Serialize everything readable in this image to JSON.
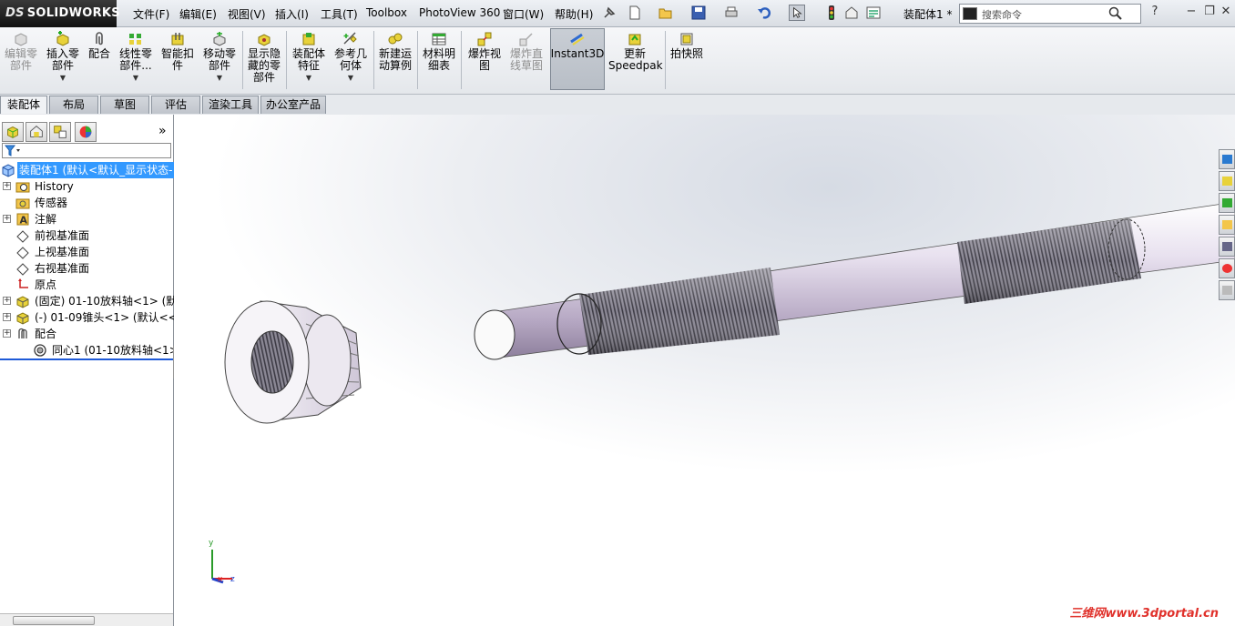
{
  "app": {
    "logo_text": "SOLIDWORKS",
    "logo_prefix": "DS"
  },
  "menu": [
    "文件(F)",
    "编辑(E)",
    "视图(V)",
    "插入(I)",
    "工具(T)",
    "Toolbox",
    "PhotoView 360",
    "窗口(W)",
    "帮助(H)"
  ],
  "document_title": "装配体1 *",
  "search": {
    "placeholder": "搜索命令"
  },
  "window_controls": {
    "help": "?",
    "minimize": "−",
    "restore": "❐",
    "close": "✕"
  },
  "command_manager": {
    "items": [
      {
        "label": "编辑零\n部件",
        "disabled": true,
        "dropdown": false
      },
      {
        "label": "插入零\n部件",
        "disabled": false,
        "dropdown": true
      },
      {
        "label": "配合",
        "disabled": false,
        "dropdown": false
      },
      {
        "label": "线性零\n部件...",
        "disabled": false,
        "dropdown": true
      },
      {
        "label": "智能扣\n件",
        "disabled": false,
        "dropdown": false
      },
      {
        "label": "移动零\n部件",
        "disabled": false,
        "dropdown": true
      },
      {
        "label": "显示隐\n藏的零\n部件",
        "disabled": false,
        "dropdown": false
      },
      {
        "label": "装配体\n特征",
        "disabled": false,
        "dropdown": true
      },
      {
        "label": "参考几\n何体",
        "disabled": false,
        "dropdown": true
      },
      {
        "label": "新建运\n动算例",
        "disabled": false,
        "dropdown": false
      },
      {
        "label": "材料明\n细表",
        "disabled": false,
        "dropdown": false
      },
      {
        "label": "爆炸视\n图",
        "disabled": false,
        "dropdown": false
      },
      {
        "label": "爆炸直\n线草图",
        "disabled": true,
        "dropdown": false
      },
      {
        "label": "Instant3D",
        "disabled": false,
        "dropdown": false
      },
      {
        "label": "更新\nSpeedpak",
        "disabled": false,
        "dropdown": false
      },
      {
        "label": "拍快照",
        "disabled": false,
        "dropdown": false
      }
    ]
  },
  "tabs": [
    "装配体",
    "布局",
    "草图",
    "评估",
    "渲染工具",
    "办公室产品"
  ],
  "feature_tree": {
    "expand_arrow": "»",
    "filter_icon": "filter-icon",
    "root": "装配体1  (默认<默认_显示状态-",
    "items": [
      {
        "label": "History",
        "icon": "history-folder-icon",
        "expandable": true
      },
      {
        "label": "传感器",
        "icon": "sensor-folder-icon",
        "expandable": false
      },
      {
        "label": "注解",
        "icon": "annotation-icon",
        "expandable": true
      },
      {
        "label": "前视基准面",
        "icon": "plane-icon",
        "expandable": false
      },
      {
        "label": "上视基准面",
        "icon": "plane-icon",
        "expandable": false
      },
      {
        "label": "右视基准面",
        "icon": "plane-icon",
        "expandable": false
      },
      {
        "label": "原点",
        "icon": "origin-icon",
        "expandable": false
      },
      {
        "label": "(固定) 01-10放料轴<1> (默",
        "icon": "part-icon",
        "expandable": true
      },
      {
        "label": "(-) 01-09锥头<1> (默认<<",
        "icon": "part-icon",
        "expandable": true
      },
      {
        "label": "配合",
        "icon": "mates-icon",
        "expandable": true
      },
      {
        "label": "同心1 (01-10放料轴<1>",
        "icon": "concentric-mate-icon",
        "expandable": false
      }
    ]
  },
  "triad": {
    "x": "x",
    "y": "y",
    "z": "z"
  },
  "watermark": "三维网www.3dportal.cn",
  "colors": {
    "selection": "#3399ff",
    "thread": "#7a7785",
    "shaft": "#c9bfd2",
    "part": "#d8d3df"
  }
}
